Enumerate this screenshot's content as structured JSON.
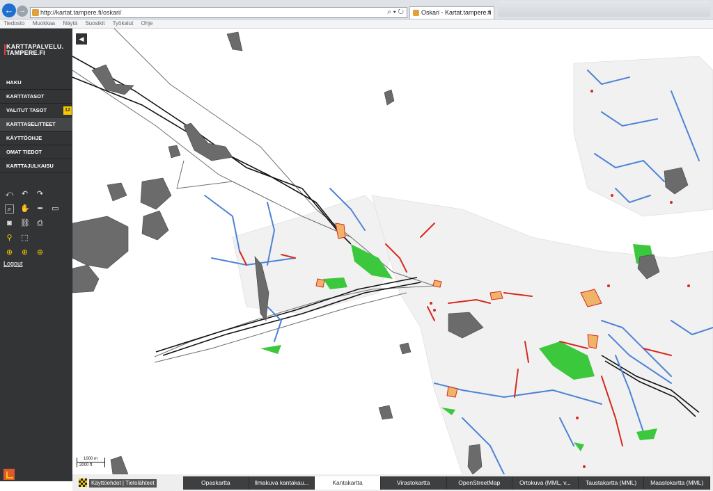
{
  "browser": {
    "url": "http://kartat.tampere.fi/oskari/",
    "tab_title": "Oskari - Kartat.tampere.fi",
    "tab_close": "×",
    "back_glyph": "←",
    "forward_glyph": "→",
    "address_tools": "⌕ ▾ ↻",
    "menu": [
      "Tiedosto",
      "Muokkaa",
      "Näytä",
      "Suosikit",
      "Työkalut",
      "Ohje"
    ]
  },
  "sidebar": {
    "logo_line1": "KARTTAPALVELU.",
    "logo_line2": "TAMPERE.FI",
    "items": [
      {
        "label": "HAKU"
      },
      {
        "label": "KARTTATASOT"
      },
      {
        "label": "VALITUT TASOT",
        "badge": "12"
      },
      {
        "label": "KARTTASELITTEET"
      },
      {
        "label": "KÄYTTÖOHJE"
      },
      {
        "label": "OMAT TIEDOT"
      },
      {
        "label": "KARTTAJULKAISU"
      }
    ],
    "logout": "Logout"
  },
  "map": {
    "collapse_glyph": "◀",
    "scale_top": "1000 m",
    "scale_bottom": "2000 ft",
    "colors": {
      "water": "#4d83d6",
      "green": "#3cc83c",
      "red": "#d42a1e",
      "orange": "#f0b469",
      "gray": "#6b6b6b"
    }
  },
  "footer": {
    "terms": "Käyttöehdot | Tietolähteet",
    "layers": [
      {
        "label": "Opaskartta"
      },
      {
        "label": "Ilmakuva kantakau..."
      },
      {
        "label": "Kantakartta",
        "active": true
      },
      {
        "label": "Virastokartta"
      },
      {
        "label": "OpenStreetMap"
      },
      {
        "label": "Ortokuva (MML, v..."
      },
      {
        "label": "Taustakartta (MML)"
      },
      {
        "label": "Maastokartta (MML)"
      }
    ]
  }
}
